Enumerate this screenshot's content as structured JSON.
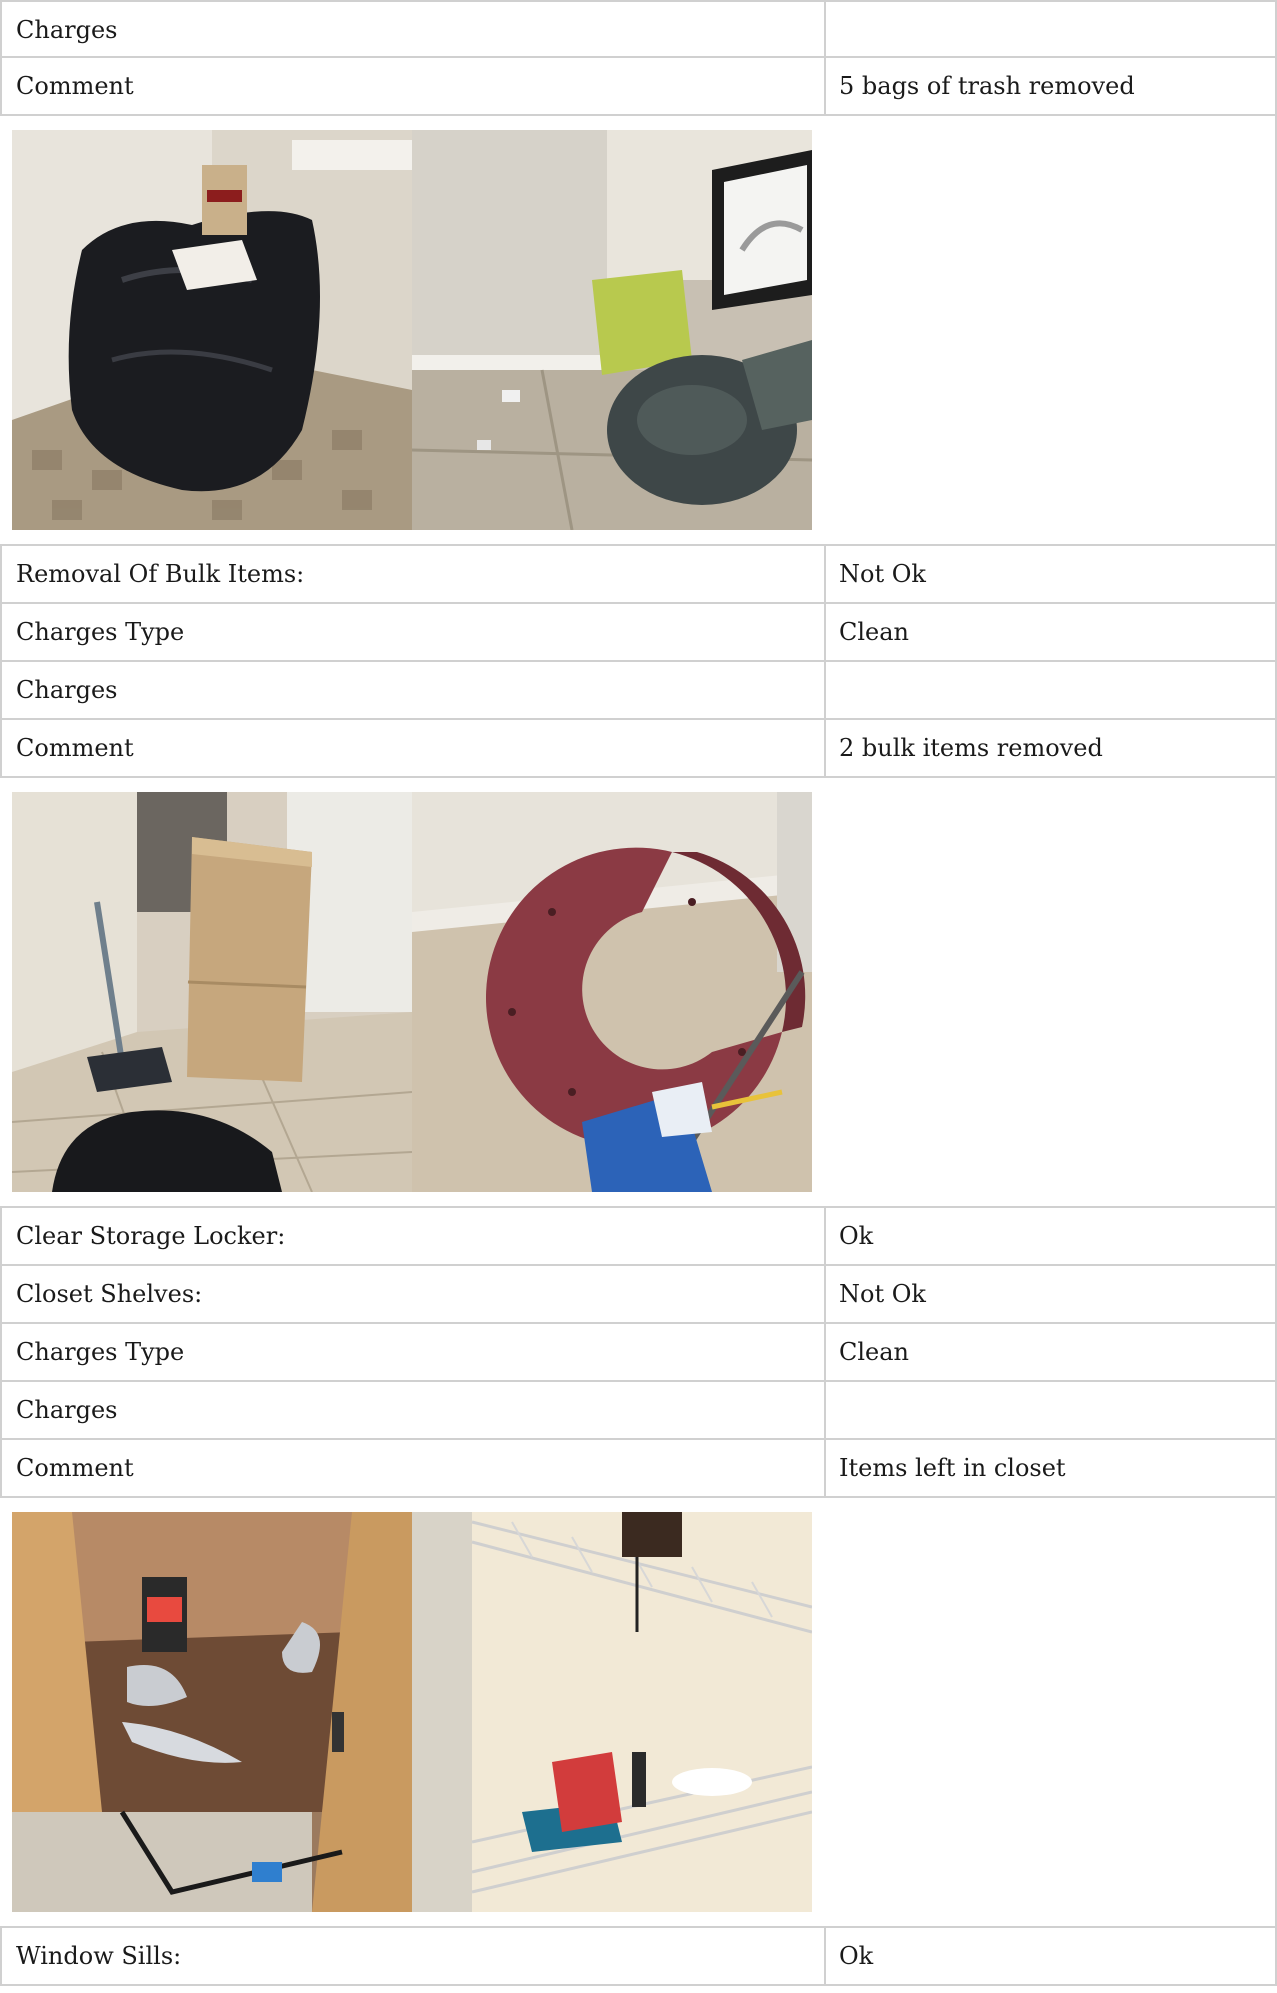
{
  "sections": [
    {
      "rows": [
        {
          "label": "Charges",
          "value": ""
        },
        {
          "label": "Comment",
          "value": "5 bags of trash removed"
        }
      ],
      "photos": [
        {
          "name": "trash-bag-corner-photo"
        },
        {
          "name": "wall-vase-debris-photo"
        }
      ]
    },
    {
      "rows": [
        {
          "label": "Removal Of Bulk Items:",
          "value": "Not Ok"
        },
        {
          "label": "Charges Type",
          "value": "Clean"
        },
        {
          "label": "Charges",
          "value": ""
        },
        {
          "label": "Comment",
          "value": "2 bulk items removed"
        }
      ],
      "photos": [
        {
          "name": "box-broom-trashbag-photo"
        },
        {
          "name": "red-letter-c-photo"
        }
      ]
    },
    {
      "rows": [
        {
          "label": "Clear Storage Locker:",
          "value": "Ok"
        },
        {
          "label": "Closet Shelves:",
          "value": "Not Ok"
        },
        {
          "label": "Charges Type",
          "value": "Clean"
        },
        {
          "label": "Charges",
          "value": ""
        },
        {
          "label": "Comment",
          "value": "Items left in closet"
        }
      ],
      "photos": [
        {
          "name": "cabinet-interior-photo"
        },
        {
          "name": "closet-wire-shelves-photo"
        }
      ]
    },
    {
      "rows": [
        {
          "label": "Window Sills:",
          "value": "Ok"
        }
      ]
    }
  ]
}
